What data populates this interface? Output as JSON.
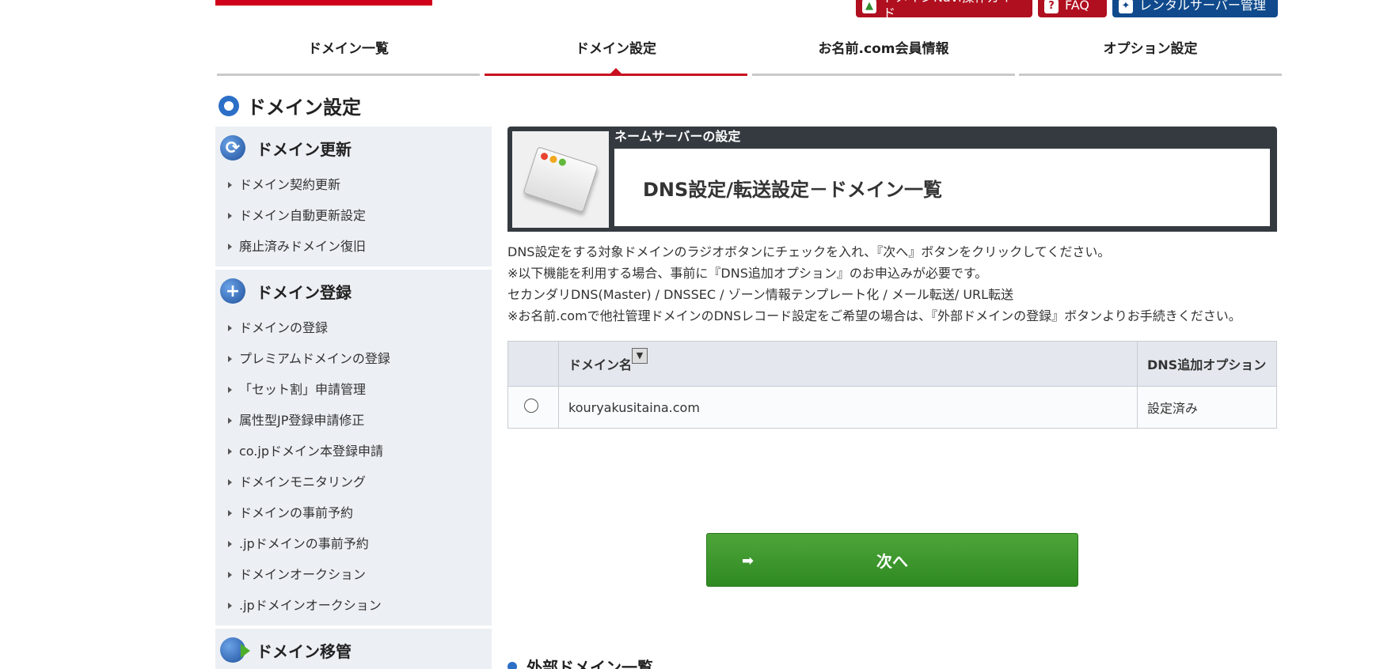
{
  "header": {
    "guide_button": "ドメインNavi操作ガイド",
    "faq_button": "FAQ",
    "rental_button": "レンタルサーバー管理"
  },
  "nav": {
    "tabs": [
      {
        "label": "ドメイン一覧"
      },
      {
        "label": "ドメイン設定"
      },
      {
        "label": "お名前.com会員情報"
      },
      {
        "label": "オプション設定"
      }
    ],
    "active_index": 1
  },
  "page_title": "ドメイン設定",
  "sidebar": {
    "groups": [
      {
        "title": "ドメイン更新",
        "icon": "refresh-icon",
        "items": [
          "ドメイン契約更新",
          "ドメイン自動更新設定",
          "廃止済みドメイン復旧"
        ]
      },
      {
        "title": "ドメイン登録",
        "icon": "plus-icon",
        "items": [
          "ドメインの登録",
          "プレミアムドメインの登録",
          "「セット割」申請管理",
          "属性型JP登録申請修正",
          "co.jpドメイン本登録申請",
          "ドメインモニタリング",
          "ドメインの事前予約",
          ".jpドメインの事前予約",
          "ドメインオークション",
          ".jpドメインオークション"
        ]
      },
      {
        "title": "ドメイン移管",
        "icon": "transfer-icon",
        "items": []
      }
    ]
  },
  "panel": {
    "subtitle": "ネームサーバーの設定",
    "title": "DNS設定/転送設定－ドメイン一覧"
  },
  "description": [
    "DNS設定をする対象ドメインのラジオボタンにチェックを入れ、『次へ』ボタンをクリックしてください。",
    "※以下機能を利用する場合、事前に『DNS追加オプション』のお申込みが必要です。",
    "セカンダリDNS(Master) / DNSSEC / ゾーン情報テンプレート化 / メール転送/ URL転送",
    "※お名前.comで他社管理ドメインのDNSレコード設定をご希望の場合は、『外部ドメインの登録』ボタンよりお手続きください。"
  ],
  "table": {
    "headers": [
      "",
      "ドメイン名",
      "DNS追加オプション"
    ],
    "sort_icon": "▼",
    "rows": [
      {
        "domain": "kouryakusitaina.com",
        "option": "設定済み"
      }
    ]
  },
  "next_button": "次へ",
  "external_section_title": "外部ドメイン一覧",
  "colors": {
    "accent_red": "#c8101e",
    "brand_blue": "#104a8c",
    "green_button": "#3a962c",
    "sidebar_bg": "#eceff4"
  }
}
